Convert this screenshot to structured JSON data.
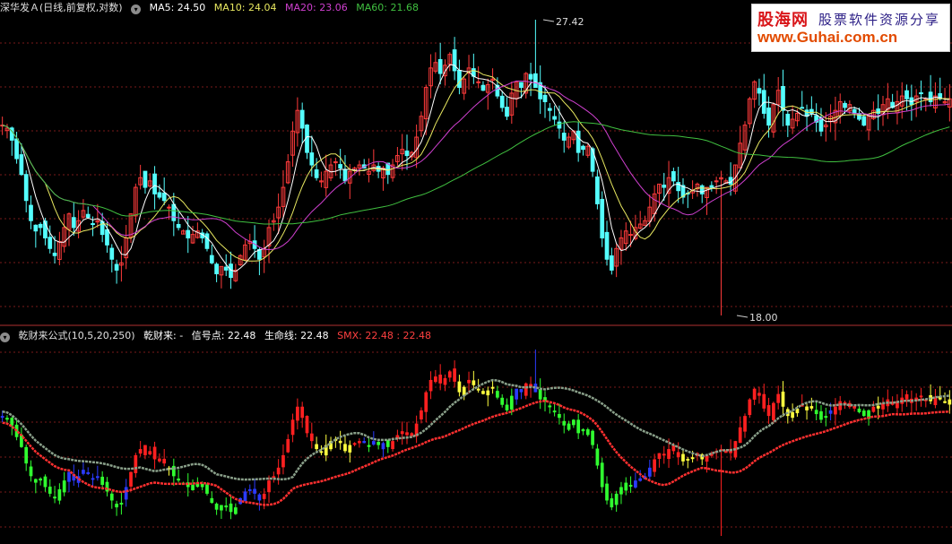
{
  "top_panel": {
    "title": "深华发Ａ(日线,前复权,对数)",
    "ma_labels": [
      {
        "text": "MA5: 24.50",
        "color": "#ffffff"
      },
      {
        "text": "MA10: 24.04",
        "color": "#e8e860"
      },
      {
        "text": "MA20: 23.06",
        "color": "#d040d0"
      },
      {
        "text": "MA60: 21.68",
        "color": "#40c040"
      }
    ],
    "max_label": "27.42",
    "min_label": "18.00"
  },
  "bottom_panel": {
    "title": "乾财来公式(10,5,20,250)",
    "labels": [
      {
        "text": "乾财来: -",
        "color": "#ffffff"
      },
      {
        "text": "信号点: 22.48",
        "color": "#ffffff"
      },
      {
        "text": "生命线: 22.48",
        "color": "#ffffff"
      },
      {
        "text": "SMX: 22.48 : 22.48",
        "color": "#ff4040"
      }
    ]
  },
  "watermark": {
    "line1a": "股海网",
    "line1b": "股票软件资源分享",
    "line2": "www.Guhai.com.cn"
  },
  "chart_data": {
    "type": "candlestick",
    "price_range": [
      18.0,
      27.42
    ],
    "price_scale": "log",
    "points": 200,
    "closes": [
      23.6,
      23.5,
      23.1,
      22.5,
      22.0,
      21.2,
      20.6,
      20.3,
      20.4,
      20.1,
      19.8,
      19.6,
      20.0,
      20.4,
      20.8,
      20.4,
      20.6,
      20.9,
      20.7,
      20.5,
      20.6,
      20.2,
      19.9,
      19.5,
      19.2,
      19.4,
      20.1,
      20.8,
      21.6,
      21.9,
      21.6,
      21.8,
      21.4,
      21.3,
      21.2,
      21.0,
      20.6,
      20.4,
      20.3,
      20.1,
      20.2,
      20.3,
      20.1,
      19.8,
      19.4,
      19.1,
      19.3,
      19.2,
      19.0,
      19.2,
      19.6,
      19.9,
      20.0,
      19.8,
      19.5,
      19.8,
      20.4,
      20.6,
      21.0,
      21.6,
      22.4,
      23.4,
      24.1,
      23.5,
      22.7,
      22.3,
      21.9,
      21.8,
      22.1,
      22.3,
      22.4,
      22.2,
      21.8,
      22.1,
      22.2,
      22.3,
      22.2,
      22.1,
      22.3,
      22.1,
      22.2,
      22.0,
      22.3,
      22.6,
      22.8,
      22.6,
      22.7,
      23.2,
      23.9,
      24.9,
      25.6,
      25.8,
      25.4,
      25.7,
      26.1,
      25.5,
      24.9,
      25.2,
      25.6,
      25.3,
      25.1,
      24.8,
      25.0,
      25.2,
      24.6,
      24.2,
      23.9,
      24.7,
      25.1,
      24.9,
      25.4,
      25.2,
      24.9,
      24.5,
      24.4,
      24.1,
      23.8,
      23.5,
      23.1,
      23.2,
      23.4,
      22.7,
      22.8,
      22.9,
      22.1,
      21.1,
      20.1,
      19.5,
      19.2,
      19.8,
      20.1,
      20.3,
      20.2,
      20.4,
      20.5,
      20.6,
      21.0,
      21.4,
      21.7,
      21.6,
      21.9,
      21.8,
      21.5,
      21.3,
      21.4,
      21.5,
      21.7,
      21.4,
      21.6,
      21.6,
      21.8,
      21.9,
      21.8,
      21.7,
      22.3,
      23.0,
      23.6,
      24.5,
      25.1,
      24.7,
      24.0,
      23.6,
      24.3,
      24.8,
      24.1,
      23.6,
      23.8,
      24.0,
      24.2,
      23.9,
      24.0,
      23.7,
      23.4,
      23.6,
      23.9,
      24.1,
      24.4,
      24.2,
      24.3,
      24.0,
      23.8,
      23.6,
      23.9,
      24.1,
      24.0,
      24.3,
      24.5,
      24.2,
      24.4,
      24.6,
      24.5,
      24.3,
      24.6,
      24.7,
      24.5,
      24.4,
      24.6,
      24.5,
      24.4,
      24.5
    ]
  }
}
